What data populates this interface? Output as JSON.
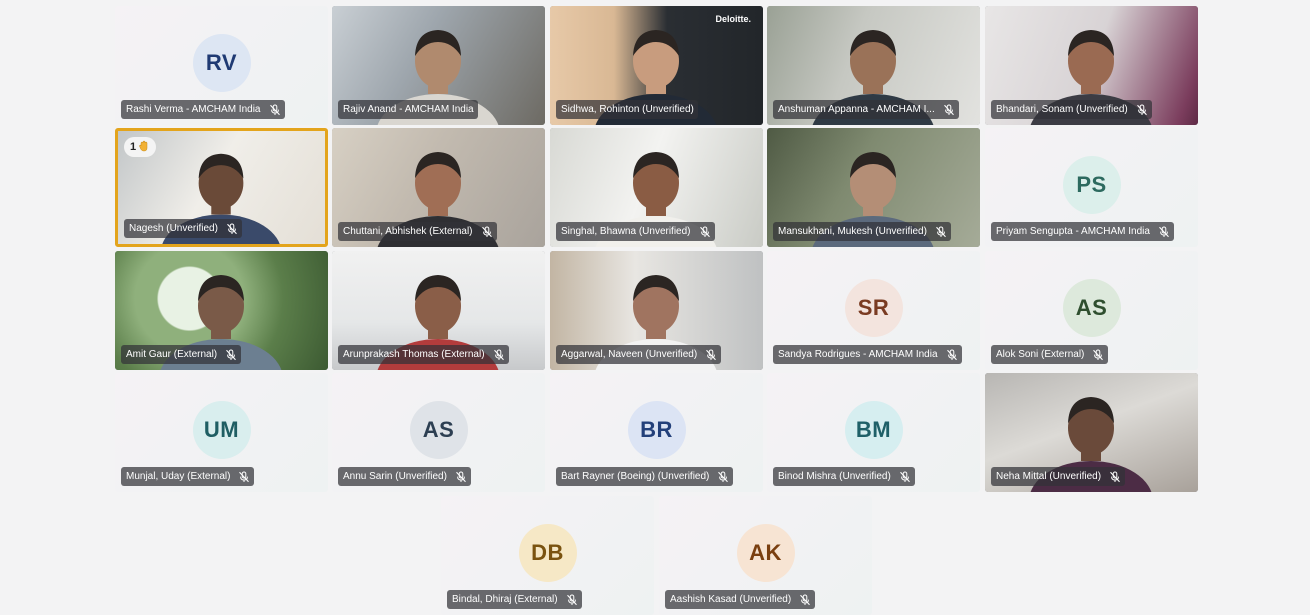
{
  "meeting": {
    "participants": [
      {
        "name": "Rashi Verma - AMCHAM India",
        "initials": "RV",
        "video": false,
        "avatar_bg": "#dde6f3",
        "avatar_fg": "#1f3a73",
        "muted": true
      },
      {
        "name": "Rajiv Anand - AMCHAM India",
        "video": true,
        "muted": false
      },
      {
        "name": "Sidhwa, Rohinton (Unverified)",
        "video": true,
        "muted": false,
        "brand_text": "Deloitte."
      },
      {
        "name": "Anshuman Appanna - AMCHAM I...",
        "video": true,
        "muted": true
      },
      {
        "name": "Bhandari, Sonam (Unverified)",
        "video": true,
        "muted": true
      },
      {
        "name": "Nagesh (Unverified)",
        "video": true,
        "muted": true,
        "pinned": true,
        "hand_raise_count": "1"
      },
      {
        "name": "Chuttani, Abhishek (External)",
        "video": true,
        "muted": true
      },
      {
        "name": "Singhal, Bhawna (Unverified)",
        "video": true,
        "muted": true
      },
      {
        "name": "Mansukhani, Mukesh (Unverified)",
        "video": true,
        "muted": true
      },
      {
        "name": "Priyam Sengupta - AMCHAM India",
        "initials": "PS",
        "video": false,
        "avatar_bg": "#dcefeb",
        "avatar_fg": "#2d6a5f",
        "muted": true
      },
      {
        "name": "Amit Gaur (External)",
        "video": true,
        "muted": true
      },
      {
        "name": "Arunprakash Thomas (External)",
        "video": true,
        "muted": true
      },
      {
        "name": "Aggarwal, Naveen (Unverified)",
        "video": true,
        "muted": true
      },
      {
        "name": "Sandya Rodrigues - AMCHAM India",
        "initials": "SR",
        "video": false,
        "avatar_bg": "#f3e4de",
        "avatar_fg": "#7a3b22",
        "muted": true
      },
      {
        "name": "Alok Soni (External)",
        "initials": "AS",
        "video": false,
        "avatar_bg": "#dde9dc",
        "avatar_fg": "#2f4f2f",
        "muted": true
      },
      {
        "name": "Munjal, Uday (External)",
        "initials": "UM",
        "video": false,
        "avatar_bg": "#d9eeee",
        "avatar_fg": "#1f5e63",
        "muted": true
      },
      {
        "name": "Annu Sarin (Unverified)",
        "initials": "AS",
        "video": false,
        "avatar_bg": "#dfe3e8",
        "avatar_fg": "#2d3f52",
        "muted": true
      },
      {
        "name": "Bart Rayner (Boeing) (Unverified)",
        "initials": "BR",
        "video": false,
        "avatar_bg": "#dce4f4",
        "avatar_fg": "#23407a",
        "muted": true
      },
      {
        "name": "Binod Mishra (Unverified)",
        "initials": "BM",
        "video": false,
        "avatar_bg": "#d6eef0",
        "avatar_fg": "#1f6068",
        "muted": true
      },
      {
        "name": "Neha Mittal (Unverified)",
        "video": true,
        "muted": true
      },
      {
        "name": "Bindal, Dhiraj (External)",
        "initials": "DB",
        "video": false,
        "avatar_bg": "#f6e8c6",
        "avatar_fg": "#7a5310",
        "muted": true
      },
      {
        "name": "Aashish Kasad (Unverified)",
        "initials": "AK",
        "video": false,
        "avatar_bg": "#f7e4d3",
        "avatar_fg": "#7a3f10",
        "muted": true
      }
    ]
  }
}
